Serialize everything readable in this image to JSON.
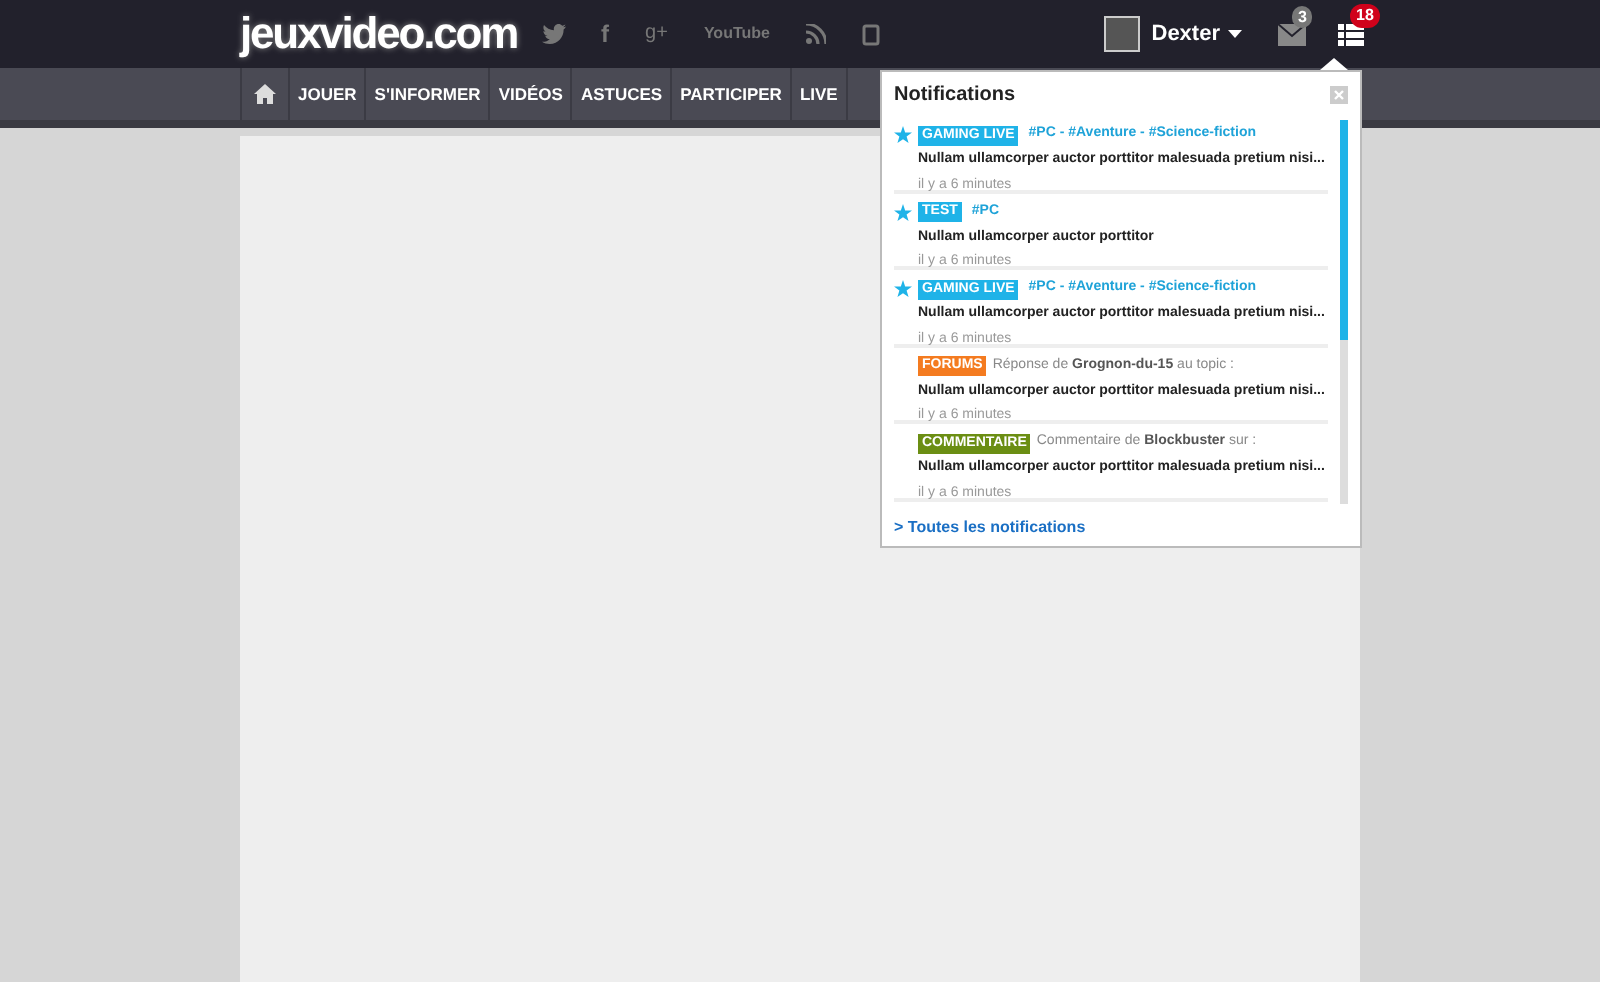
{
  "header": {
    "logo": "jeuxvideo.com",
    "user": "Dexter",
    "messages_count": "3",
    "notifications_count": "18",
    "social": [
      "f",
      "g+",
      "YouTube"
    ]
  },
  "nav": {
    "items": [
      {
        "label": "JOUER"
      },
      {
        "label": "S'INFORMER"
      },
      {
        "label": "VIDÉOS"
      },
      {
        "label": "ASTUCES"
      },
      {
        "label": "PARTICIPER"
      },
      {
        "label": "LIVE"
      }
    ]
  },
  "notifications": {
    "title": "Notifications",
    "items": [
      {
        "tag": "GAMING LIVE",
        "color": "#1fb3e8",
        "starred": true,
        "kind": "tags",
        "meta": "#PC - #Aventure - #Science-fiction",
        "text": "Nullam ullamcorper auctor porttitor malesuada pretium nisi...",
        "time": "il y a 6 minutes"
      },
      {
        "tag": "TEST",
        "color": "#1fb3e8",
        "starred": true,
        "kind": "tags",
        "meta": "#PC",
        "text": "Nullam ullamcorper auctor porttitor",
        "time": "il y a 6 minutes"
      },
      {
        "tag": "GAMING LIVE",
        "color": "#1fb3e8",
        "starred": true,
        "kind": "tags",
        "meta": "#PC - #Aventure - #Science-fiction",
        "text": "Nullam ullamcorper auctor porttitor malesuada pretium nisi...",
        "time": "il y a 6 minutes"
      },
      {
        "tag": "FORUMS",
        "color": "#f47b20",
        "starred": false,
        "kind": "activity",
        "meta": "Réponse de **Grognon-du-15** au topic :",
        "text": "Nullam ullamcorper auctor porttitor malesuada pretium nisi...",
        "time": "il y a 6 minutes"
      },
      {
        "tag": "COMMENTAIRE",
        "color": "#6b8e13",
        "starred": false,
        "kind": "activity",
        "meta": "Commentaire de **Blockbuster** sur :",
        "text": "Nullam ullamcorper auctor porttitor malesuada pretium nisi...",
        "time": "il y a 6 minutes"
      }
    ],
    "footer_link": "> Toutes les notifications"
  }
}
